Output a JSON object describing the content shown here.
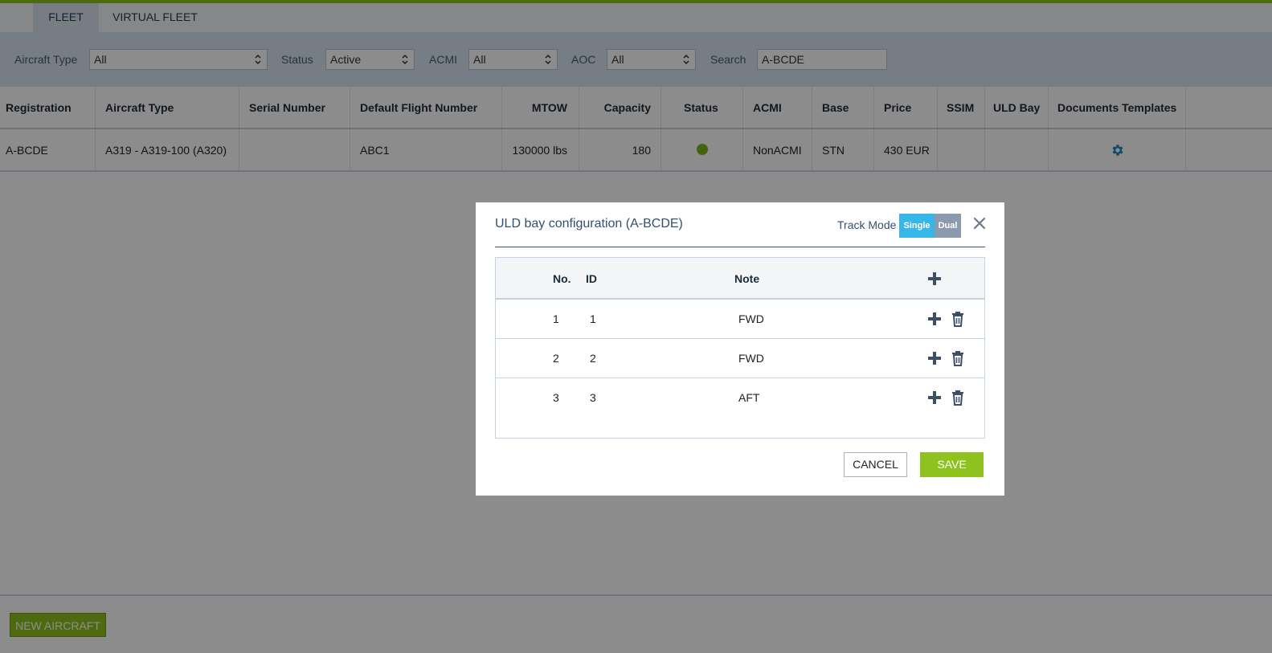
{
  "tabs": [
    {
      "label": "FLEET",
      "active": true
    },
    {
      "label": "VIRTUAL FLEET",
      "active": false
    }
  ],
  "filters": {
    "aircraft_type": {
      "label": "Aircraft Type",
      "value": "All"
    },
    "status": {
      "label": "Status",
      "value": "Active"
    },
    "acmi": {
      "label": "ACMI",
      "value": "All"
    },
    "aoc": {
      "label": "AOC",
      "value": "All"
    },
    "search": {
      "label": "Search",
      "value": "A-BCDE"
    }
  },
  "grid": {
    "columns": [
      "Registration",
      "Aircraft Type",
      "Serial Number",
      "Default Flight Number",
      "MTOW",
      "Capacity",
      "Status",
      "ACMI",
      "Base",
      "Price",
      "SSIM",
      "ULD Bay",
      "Documents Templates"
    ],
    "rows": [
      {
        "registration": "A-BCDE",
        "aircraft_type": "A319 - A319-100 (A320)",
        "serial_number": "",
        "default_flight_number": "ABC1",
        "mtow": "130000 lbs",
        "capacity": "180",
        "status": "active",
        "acmi": "NonACMI",
        "base": "STN",
        "price": "430 EUR",
        "ssim": "",
        "uld_bay": "",
        "documents_icon": "gear-icon"
      }
    ]
  },
  "footer": {
    "new_aircraft_label": "NEW AIRCRAFT"
  },
  "modal": {
    "title": "ULD bay configuration (A-BCDE)",
    "track_mode_label": "Track Mode",
    "track_mode_options": [
      "Single",
      "Dual"
    ],
    "track_mode_selected": "Single",
    "table": {
      "headers": {
        "no": "No.",
        "id": "ID",
        "note": "Note"
      },
      "rows": [
        {
          "no": "1",
          "id": "1",
          "note": "FWD"
        },
        {
          "no": "2",
          "id": "2",
          "note": "FWD"
        },
        {
          "no": "3",
          "id": "3",
          "note": "AFT"
        }
      ]
    },
    "cancel_label": "CANCEL",
    "save_label": "SAVE"
  },
  "colors": {
    "accent_green": "#8dc21f",
    "toggle_active": "#37b6ea",
    "toggle_inactive": "#8c9aae",
    "title_blue": "#33506e"
  }
}
